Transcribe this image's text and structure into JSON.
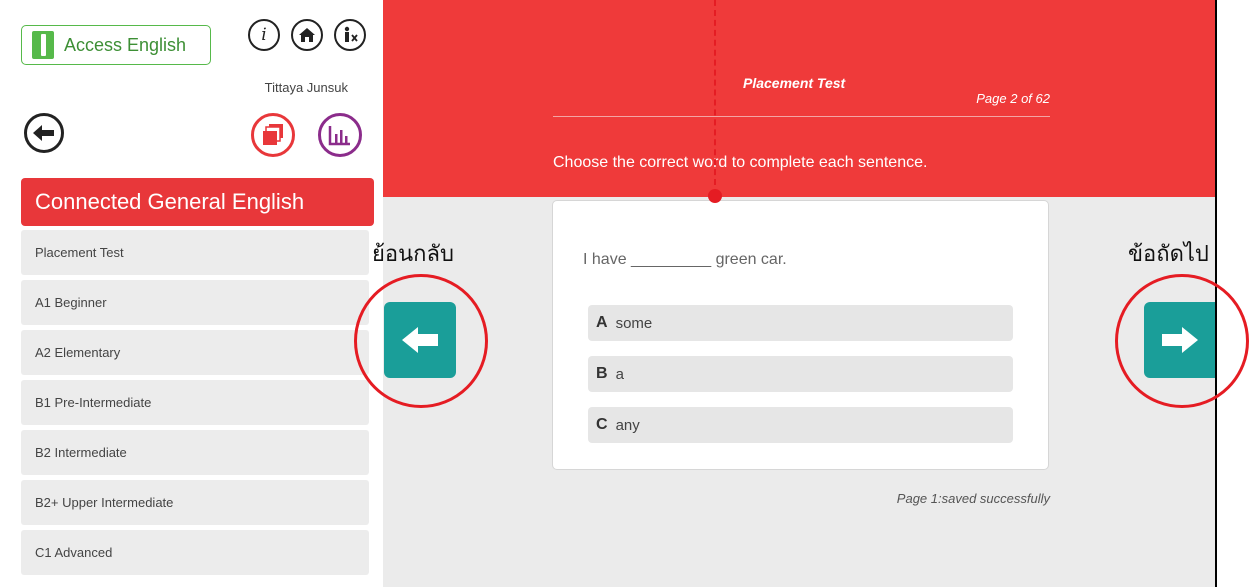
{
  "sidebar": {
    "app_name": "Access English",
    "user_name": "Tittaya Junsuk",
    "course_title": "Connected General English",
    "levels": [
      "Placement Test",
      "A1 Beginner",
      "A2 Elementary",
      "B1 Pre-Intermediate",
      "B2 Intermediate",
      "B2+ Upper Intermediate",
      "C1 Advanced"
    ]
  },
  "header": {
    "test_name": "Placement Test",
    "page_indicator": "Page 2 of 62",
    "instruction": "Choose the correct word to complete each sentence."
  },
  "question": {
    "text": "I have _________ green car.",
    "options": [
      {
        "letter": "A",
        "text": "some"
      },
      {
        "letter": "B",
        "text": "a"
      },
      {
        "letter": "C",
        "text": "any"
      }
    ]
  },
  "status": "Page 1:saved successfully",
  "annotations": {
    "back_label": "ย้อนกลับ",
    "next_label": "ข้อถัดไป"
  },
  "colors": {
    "accent_red": "#ef3a3a",
    "teal": "#1a9e99",
    "brand_green": "#56b94a",
    "annotation_red": "#e51c23",
    "stats_purple": "#8b2c8b"
  },
  "icons": {
    "info": "info-icon",
    "home": "home-icon",
    "accessibility": "accessibility-icon",
    "back": "back-arrow-icon",
    "copy": "stacked-pages-icon",
    "stats": "bar-chart-icon",
    "prev": "left-arrow-icon",
    "next": "right-arrow-icon"
  }
}
